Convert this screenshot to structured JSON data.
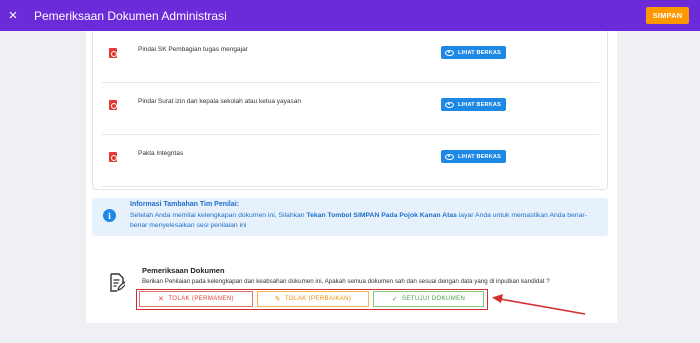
{
  "header": {
    "title": "Pemeriksaan Dokumen Administrasi",
    "save_label": "SIMPAN",
    "close_icon": "×"
  },
  "documents": [
    {
      "label": "Pindai SK Pembagian tugas mengajar",
      "button": "LIHAT BERKAS"
    },
    {
      "label": "Pindai Surat izin dari kepala sekolah atau ketua yayasan",
      "button": "LIHAT BERKAS"
    },
    {
      "label": "Pakta Integritas",
      "button": "LIHAT BERKAS"
    }
  ],
  "info": {
    "icon": "i",
    "title": "Informasi Tambahan Tim Penilai:",
    "text_pre": "Setelah Anda memilai kelengkapan dokumen ini, Silahkan ",
    "text_bold": "Tekan Tombol SIMPAN Pada Pojok Kanan Atas",
    "text_post": " layar Anda untuk memastikan Anda benar-benar menyelesaikan sesi penilaian ini"
  },
  "review": {
    "title": "Pemeriksaan Dokumen",
    "description": "Berikan Penilaian pada kelengkapan dan keabsahan dokumen ini, Apakah semua dokumen sah dan sesuai dengan data yang di inputkan kandidat ?",
    "reject_permanent": "TOLAK (PERMANEN)",
    "reject_fix": "TOLAK (PERBAIKAN)",
    "approve": "SETUJUI DOKUMEN"
  },
  "colors": {
    "header": "#6c2bd9",
    "save": "#ff9800",
    "view_button": "#1e88e5",
    "reject": "#e53935",
    "fix": "#ef8c00",
    "approve": "#43a047",
    "highlight": "#d32f2f"
  }
}
